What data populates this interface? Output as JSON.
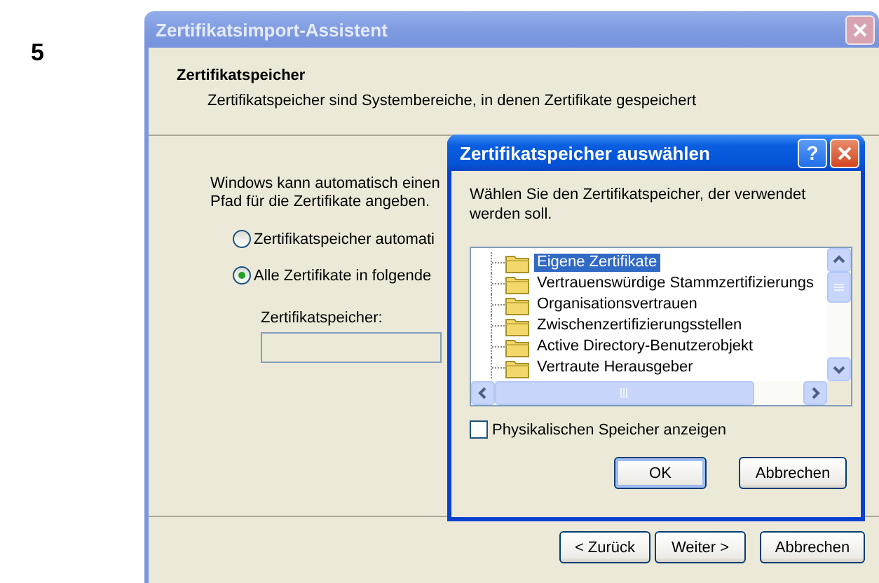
{
  "step_number": "5",
  "wizard": {
    "title": "Zertifikatsimport-Assistent",
    "header_title": "Zertifikatspeicher",
    "header_subtitle": "Zertifikatspeicher sind Systembereiche, in denen Zertifikate gespeichert",
    "intro": [
      "Windows kann automatisch einen",
      "Pfad für die Zertifikate angeben."
    ],
    "options": [
      {
        "label": "Zertifikatspeicher automati",
        "selected": false
      },
      {
        "label": "Alle Zertifikate in folgende",
        "selected": true
      }
    ],
    "store_label": "Zertifikatspeicher:",
    "buttons": [
      {
        "label": "< Zurück"
      },
      {
        "label": "Weiter >"
      },
      {
        "label": "Abbrechen"
      }
    ]
  },
  "dialog": {
    "title": "Zertifikatspeicher auswählen",
    "help_button": "?",
    "instruction": "Wählen Sie den Zertifikatspeicher, der verwendet werden soll.",
    "stores": [
      {
        "label": "Eigene Zertifikate",
        "selected": true
      },
      {
        "label": "Vertrauenswürdige Stammzertifizierungs",
        "selected": false
      },
      {
        "label": "Organisationsvertrauen",
        "selected": false
      },
      {
        "label": "Zwischenzertifizierungsstellen",
        "selected": false
      },
      {
        "label": "Active Directory-Benutzerobjekt",
        "selected": false
      },
      {
        "label": "Vertraute Herausgeber",
        "selected": false
      }
    ],
    "show_physical": {
      "label": "Physikalischen Speicher anzeigen",
      "checked": false
    },
    "buttons": [
      {
        "label": "OK",
        "default": true
      },
      {
        "label": "Abbrechen",
        "default": false
      }
    ]
  }
}
